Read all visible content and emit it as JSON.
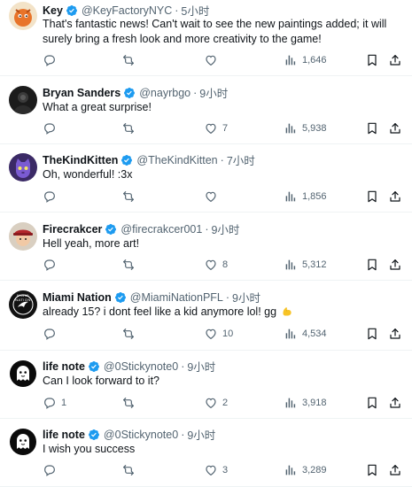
{
  "colors": {
    "verified": "#1d9bf0",
    "muted": "#536471",
    "text": "#0f1419",
    "divider": "#eff3f4"
  },
  "tweets": [
    {
      "name": "Key",
      "handle": "@KeyFactoryNYC",
      "time": "5小时",
      "text": "That's fantastic news! Can't wait to see the new paintings added; it will surely bring a fresh look and more creativity to the game!",
      "replies": "",
      "retweets": "",
      "likes": "",
      "views": "1,646",
      "avatar": "orange-character-avatar"
    },
    {
      "name": "Bryan Sanders",
      "handle": "@nayrbgo",
      "time": "9小时",
      "text": "What a great surprise!",
      "replies": "",
      "retweets": "",
      "likes": "7",
      "views": "5,938",
      "avatar": "dark-portrait-avatar"
    },
    {
      "name": "TheKindKitten",
      "handle": "@TheKindKitten",
      "time": "7小时",
      "text": "Oh, wonderful! :3x",
      "replies": "",
      "retweets": "",
      "likes": "",
      "views": "1,856",
      "avatar": "purple-cat-avatar"
    },
    {
      "name": "Firecrakcer",
      "handle": "@firecrakcer001",
      "time": "9小时",
      "text": "Hell yeah, more art!",
      "replies": "",
      "retweets": "",
      "likes": "8",
      "views": "5,312",
      "avatar": "character-with-hat-avatar"
    },
    {
      "name": "Miami Nation",
      "handle": "@MiamiNationPFL",
      "time": "9小时",
      "text": "already 15? i dont feel like a kid anymore lol! gg",
      "text_emoji": "flexed-biceps",
      "replies": "",
      "retweets": "",
      "likes": "10",
      "views": "4,534",
      "avatar": "miami-nation-logo-avatar",
      "avatar_text": "MIAMI NATION"
    },
    {
      "name": "life note",
      "handle": "@0Stickynote0",
      "time": "9小时",
      "text": "Can I look forward to it?",
      "replies": "1",
      "retweets": "",
      "likes": "2",
      "views": "3,918",
      "avatar": "black-ghost-avatar"
    },
    {
      "name": "life note",
      "handle": "@0Stickynote0",
      "time": "9小时",
      "text": "I wish you success",
      "replies": "",
      "retweets": "",
      "likes": "3",
      "views": "3,289",
      "avatar": "black-ghost-avatar"
    }
  ],
  "separator": "·"
}
